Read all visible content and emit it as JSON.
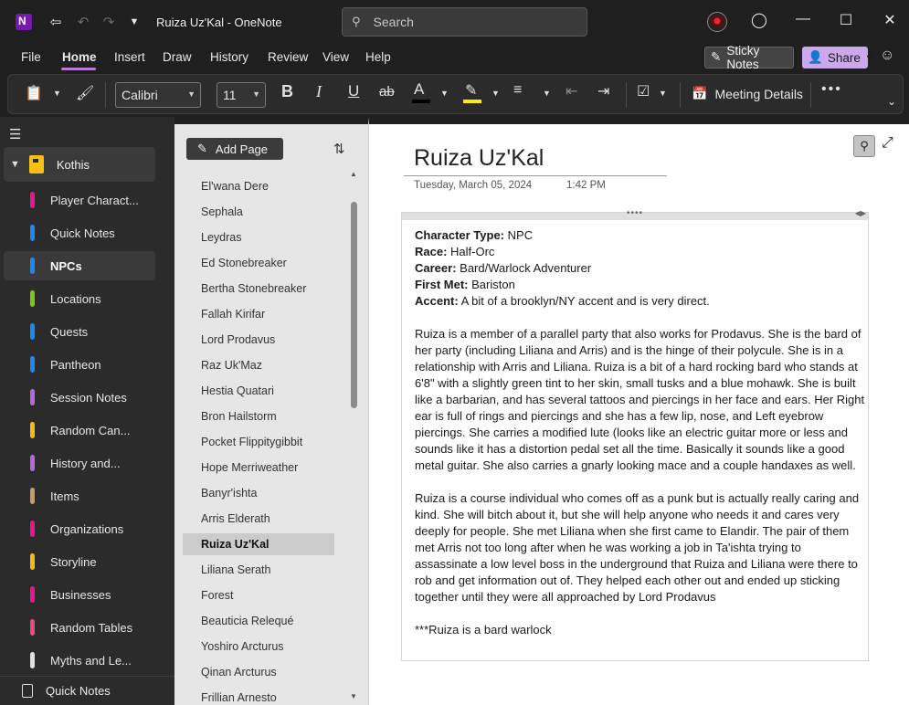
{
  "titlebar": {
    "title": "Ruiza Uz'Kal  -  OneNote",
    "search_placeholder": "Search"
  },
  "menu": {
    "items": [
      "File",
      "Home",
      "Insert",
      "Draw",
      "History",
      "Review",
      "View",
      "Help"
    ],
    "active": "Home",
    "sticky_notes": "Sticky Notes",
    "share": "Share"
  },
  "ribbon": {
    "font": "Calibri",
    "size": "11",
    "meeting_details": "Meeting Details",
    "font_color": "#000000",
    "highlight_color": "#ffee00"
  },
  "nav": {
    "notebook": "Kothis",
    "sections": [
      {
        "label": "Player Charact...",
        "color": "#e8178a"
      },
      {
        "label": "Quick Notes",
        "color": "#1b8af0"
      },
      {
        "label": "NPCs",
        "color": "#1b8af0"
      },
      {
        "label": "Locations",
        "color": "#7bc51f"
      },
      {
        "label": "Quests",
        "color": "#1b8af0"
      },
      {
        "label": "Pantheon",
        "color": "#1b8af0"
      },
      {
        "label": "Session Notes",
        "color": "#b06bd8"
      },
      {
        "label": "Random Can...",
        "color": "#f5b914"
      },
      {
        "label": "History and...",
        "color": "#b06bd8"
      },
      {
        "label": "Items",
        "color": "#c59a6d"
      },
      {
        "label": "Organizations",
        "color": "#e8178a"
      },
      {
        "label": "Storyline",
        "color": "#f5b914"
      },
      {
        "label": "Businesses",
        "color": "#e8178a"
      },
      {
        "label": "Random Tables",
        "color": "#e84a7a"
      },
      {
        "label": "Myths and Le...",
        "color": "#e0e0e0"
      }
    ],
    "active_section": "NPCs",
    "bottom": "Quick Notes"
  },
  "pages": {
    "add_label": "Add Page",
    "items": [
      "El'wana Dere",
      "Sephala",
      "Leydras",
      "Ed Stonebreaker",
      "Bertha Stonebreaker",
      "Fallah Kirifar",
      "Lord Prodavus",
      "Raz Uk'Maz",
      "Hestia Quatari",
      "Bron Hailstorm",
      "Pocket Flippitygibbit",
      "Hope Merriweather",
      "Banyr'ishta",
      "Arris Elderath",
      "Ruiza Uz'Kal",
      "Liliana Serath",
      "Forest",
      "Beauticia Relequé",
      "Yoshiro Arcturus",
      "Qinan Arcturus",
      "Frillian Arnesto"
    ],
    "active": "Ruiza Uz'Kal"
  },
  "page": {
    "title": "Ruiza Uz'Kal",
    "date": "Tuesday, March 05, 2024",
    "time": "1:42 PM",
    "fields": [
      {
        "label": "Character Type:",
        "value": "NPC"
      },
      {
        "label": "Race:",
        "value": "Half-Orc"
      },
      {
        "label": "Career:",
        "value": "Bard/Warlock Adventurer"
      },
      {
        "label": "First Met:",
        "value": "Bariston"
      },
      {
        "label": "Accent:",
        "value": "A bit of a brooklyn/NY accent and is very direct."
      }
    ],
    "paragraphs": [
      "Ruiza is a member of a parallel party that also works for Prodavus. She is the bard of her party (including Liliana and Arris) and is the hinge of their polycule. She is in a relationship with Arris and Liliana. Ruiza is a bit of a hard rocking bard who stands at 6'8\" with a slightly green tint to her skin, small tusks and a blue mohawk. She is built like a barbarian, and has several tattoos and piercings in her face and ears. Her Right ear is full of rings and piercings and she has a few lip, nose, and Left eyebrow piercings. She carries a modified lute (looks like an electric guitar more or less and sounds like it has a distortion pedal set all the time. Basically it sounds like a good metal guitar. She also carries a gnarly looking mace and a couple handaxes as well.",
      "Ruiza is a course individual who comes off as a punk but is actually really caring and kind. She will bitch about it, but she will help anyone who needs it and cares very deeply for people. She met Liliana when she first came to Elandir. The pair of them met Arris not too long after when he was working a job in Ta'ishta trying to assassinate a low level boss in the underground that Ruiza and Liliana were there to rob and get information out of. They helped each other out and ended up sticking together until they were all approached by Lord Prodavus",
      "***Ruiza is a bard warlock"
    ]
  }
}
